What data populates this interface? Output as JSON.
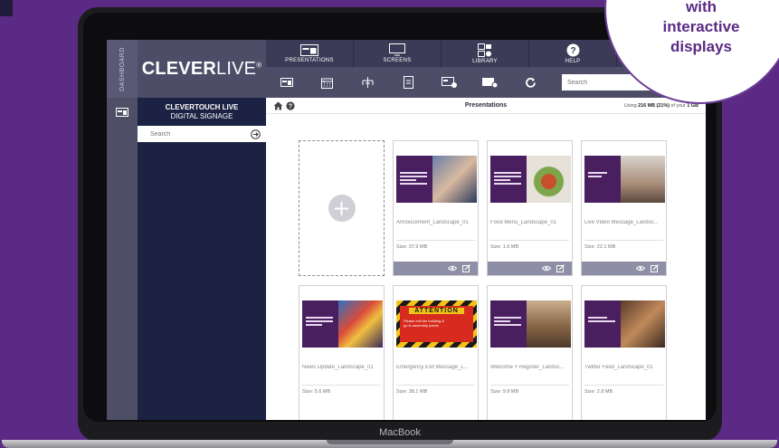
{
  "colors": {
    "background": "#5a2a84",
    "sidebar": "#1c2244",
    "nav": "#3b3b57",
    "toolbar": "#4d4d68",
    "card_bar": "#8e8ea6",
    "accent": "#4a1f60"
  },
  "laptop": {
    "brand": "MacBook"
  },
  "bubble": {
    "line1": "with",
    "line2": "interactive",
    "line3": "displays"
  },
  "dashboard": {
    "label": "DASHBOARD"
  },
  "logo": {
    "bold": "CLEVER",
    "light": "LIVE",
    "reg": "®"
  },
  "sidebar": {
    "title_1": "CLEVERTOUCH LIVE",
    "title_2": "DIGITAL SIGNAGE",
    "search_placeholder": "Search"
  },
  "topnav": {
    "tabs": [
      {
        "label": "PRESENTATIONS",
        "icon": "presentation-icon"
      },
      {
        "label": "SCREENS",
        "icon": "monitor-icon"
      },
      {
        "label": "LIBRARY",
        "icon": "library-icon"
      },
      {
        "label": "HELP",
        "icon": "help-icon"
      },
      {
        "label": "",
        "icon": ""
      }
    ]
  },
  "toolbar": {
    "icons": [
      "layout-icon",
      "calendar-icon",
      "network-icon",
      "file-icon",
      "add-layout-icon",
      "add-screen-icon",
      "refresh-icon"
    ],
    "search_placeholder": "Search"
  },
  "content": {
    "title": "Presentations",
    "usage_prefix": "Using ",
    "usage_used": "216 MB (21%)",
    "usage_mid": " of your ",
    "usage_total": "1 GB"
  },
  "presentations": [
    {
      "name": "Annoucement_Landscape_01",
      "size": "Size: 37.9 MB",
      "icon": "announcement-thumbnail"
    },
    {
      "name": "Food Menu_Landscape_01",
      "size": "Size: 1.6 MB",
      "icon": "food-thumbnail"
    },
    {
      "name": "Live Video Message_Landsc...",
      "size": "Size: 22.1 MB",
      "icon": "video-thumbnail"
    },
    {
      "name": "News Update_Landscape_01",
      "size": "Size: 5.6 MB",
      "icon": "news-thumbnail"
    },
    {
      "name": "Emergency Exit Message_L...",
      "size": "Size: 38.1 MB",
      "icon": "emergency-thumbnail"
    },
    {
      "name": "Welcome + Register_Landsc...",
      "size": "Size: 9.8 MB",
      "icon": "welcome-thumbnail"
    },
    {
      "name": "Twitter Feed_Landscape_01",
      "size": "Size: 2.8 MB",
      "icon": "twitter-thumbnail"
    }
  ],
  "emergency": {
    "word": "ATTENTION",
    "text": "Please exit the building & go to assembly points"
  }
}
